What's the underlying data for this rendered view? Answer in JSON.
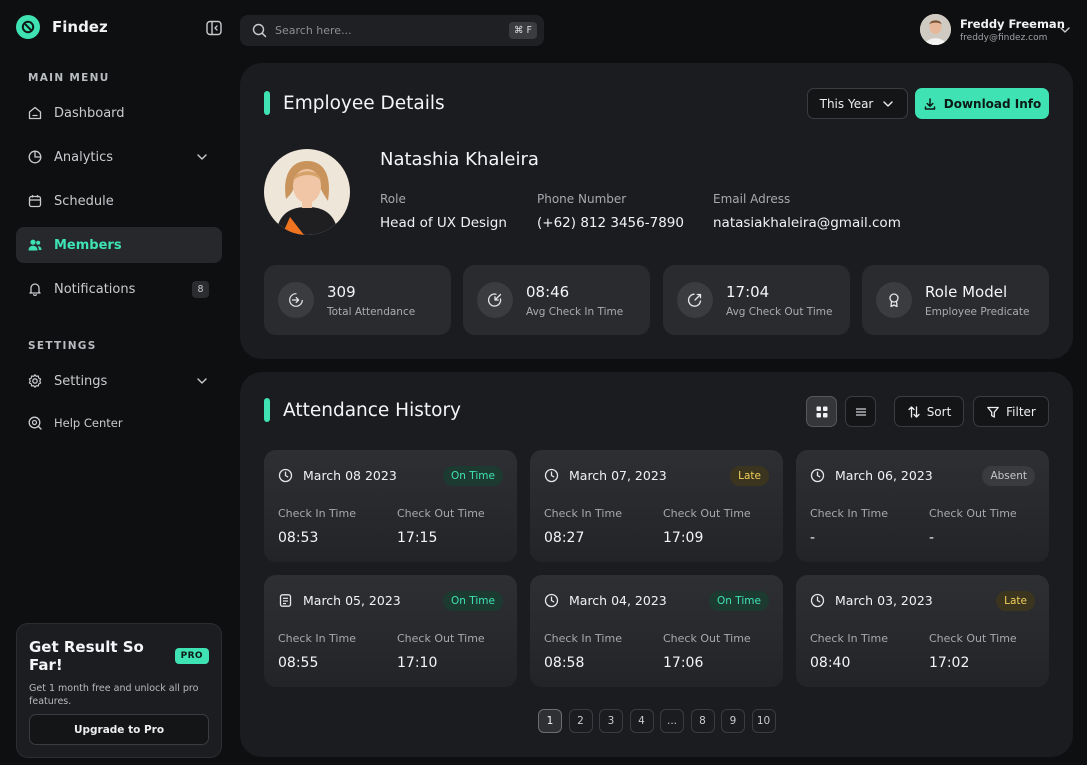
{
  "app": {
    "name": "Findez"
  },
  "search": {
    "placeholder": "Search here...",
    "shortcut": "⌘ F"
  },
  "user": {
    "name": "Freddy Freeman",
    "email": "freddy@findez.com"
  },
  "sidebar": {
    "main_menu_title": "MAIN MENU",
    "items": [
      {
        "label": "Dashboard"
      },
      {
        "label": "Analytics"
      },
      {
        "label": "Schedule"
      },
      {
        "label": "Members"
      },
      {
        "label": "Notifications",
        "badge": "8"
      }
    ],
    "settings_title": "SETTINGS",
    "settings_items": [
      {
        "label": "Settings"
      },
      {
        "label": "Help Center"
      }
    ]
  },
  "promo": {
    "title": "Get Result So Far!",
    "badge": "PRO",
    "text": "Get 1 month free and unlock all pro features.",
    "button": "Upgrade to Pro"
  },
  "employee": {
    "section_title": "Employee Details",
    "period": "This Year",
    "download_label": "Download Info",
    "name": "Natashia Khaleira",
    "fields": [
      {
        "label": "Role",
        "value": "Head of UX Design"
      },
      {
        "label": "Phone Number",
        "value": "(+62) 812 3456-7890"
      },
      {
        "label": "Email Adress",
        "value": "natasiakhaleira@gmail.com"
      }
    ],
    "stats": [
      {
        "value": "309",
        "label": "Total Attendance",
        "icon": "arrow-in-icon"
      },
      {
        "value": "08:46",
        "label": "Avg Check In Time",
        "icon": "check-in-icon"
      },
      {
        "value": "17:04",
        "label": "Avg Check Out Time",
        "icon": "check-out-icon"
      },
      {
        "value": "Role Model",
        "label": "Employee Predicate",
        "icon": "award-icon"
      }
    ]
  },
  "attendance": {
    "section_title": "Attendance History",
    "sort_label": "Sort",
    "filter_label": "Filter",
    "check_in_label": "Check In Time",
    "check_out_label": "Check Out Time",
    "records": [
      {
        "date": "March 08 2023",
        "status": "On Time",
        "check_in": "08:53",
        "check_out": "17:15"
      },
      {
        "date": "March 07, 2023",
        "status": "Late",
        "check_in": "08:27",
        "check_out": "17:09"
      },
      {
        "date": "March 06, 2023",
        "status": "Absent",
        "check_in": "-",
        "check_out": "-"
      },
      {
        "date": "March 05, 2023",
        "status": "On Time",
        "check_in": "08:55",
        "check_out": "17:10"
      },
      {
        "date": "March 04, 2023",
        "status": "On Time",
        "check_in": "08:58",
        "check_out": "17:06"
      },
      {
        "date": "March 03, 2023",
        "status": "Late",
        "check_in": "08:40",
        "check_out": "17:02"
      }
    ],
    "pages": [
      "1",
      "2",
      "3",
      "4",
      "...",
      "8",
      "9",
      "10"
    ],
    "current_page": "1"
  },
  "colors": {
    "accent": "#3fe2b3",
    "late": "#f1cf5b",
    "background": "#0e0f11",
    "panel": "#1b1c1f"
  }
}
